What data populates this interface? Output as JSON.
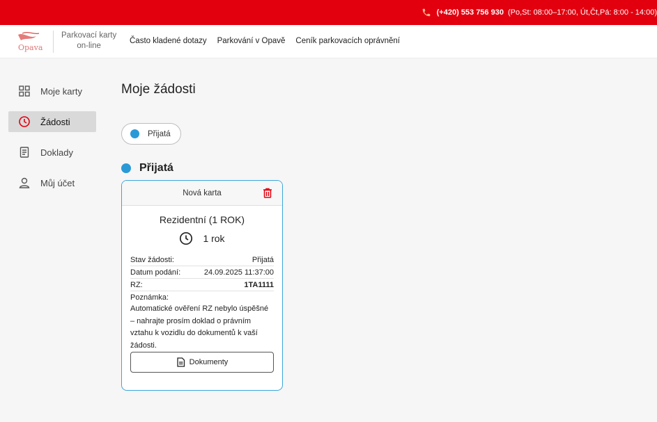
{
  "topbar": {
    "phone": "(+420) 553 756 930",
    "hours": "(Po,St: 08:00–17:00, Út,Čt,Pá: 8:00 - 14:00)"
  },
  "navbar": {
    "logo_text": "Opava",
    "app_name_line1": "Parkovací karty",
    "app_name_line2": "on-line",
    "links": [
      "Často kladené dotazy",
      "Parkování v Opavě",
      "Ceník parkovacích oprávnění"
    ]
  },
  "sidebar": {
    "items": [
      {
        "label": "Moje karty",
        "icon": "grid-icon"
      },
      {
        "label": "Žádosti",
        "icon": "clock-icon",
        "active": true
      },
      {
        "label": "Doklady",
        "icon": "receipt-icon"
      },
      {
        "label": "Můj účet",
        "icon": "user-icon"
      }
    ]
  },
  "main": {
    "title": "Moje žádosti",
    "filter_chip": "Přijatá",
    "section_title": "Přijatá",
    "status_color": "#2a9ad6"
  },
  "card": {
    "header": "Nová karta",
    "title": "Rezidentní (1 ROK)",
    "duration": "1 rok",
    "rows": [
      {
        "label": "Stav žádosti:",
        "value": "Přijatá"
      },
      {
        "label": "Datum podání:",
        "value": "24.09.2025 11:37:00"
      },
      {
        "label": "RZ:",
        "value": "1TA1111"
      }
    ],
    "note_label": "Poznámka:",
    "note_text": "Automatické ověření RZ nebylo úspěšné – nahrajte prosím doklad o právním vztahu k vozidlu do dokumentů k vaší žádosti.",
    "documents_button": "Dokumenty"
  },
  "colors": {
    "brand_red": "#e2000f",
    "accent_blue": "#2a9ad6",
    "card_border": "#3aa6d9"
  }
}
